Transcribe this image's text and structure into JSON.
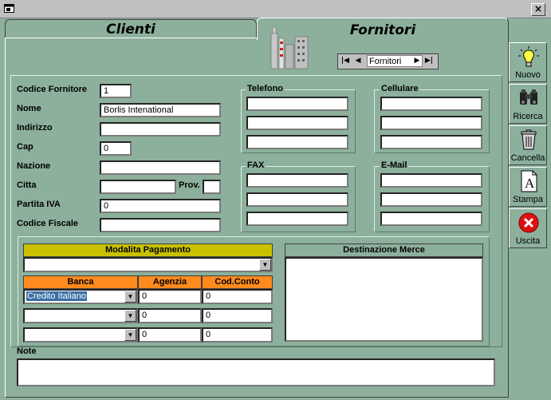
{
  "window": {
    "close_glyph": "×"
  },
  "tabs": [
    {
      "label": "Clienti"
    },
    {
      "label": "Fornitori"
    }
  ],
  "nav": {
    "first": "|◀",
    "prev": "◀",
    "label": "Fornitori",
    "next": "▶",
    "last": "▶|"
  },
  "form": {
    "codice_label": "Codice Fornitore",
    "codice_value": "1",
    "nome_label": "Nome",
    "nome_value": "Borlis Intenational",
    "indirizzo_label": "Indirizzo",
    "indirizzo_value": "",
    "cap_label": "Cap",
    "cap_value": "0",
    "nazione_label": "Nazione",
    "nazione_value": "",
    "citta_label": "Citta",
    "citta_value": "",
    "prov_label": "Prov.",
    "prov_value": "",
    "piva_label": "Partita IVA",
    "piva_value": "0",
    "cf_label": "Codice Fiscale",
    "cf_value": ""
  },
  "contacts": {
    "telefono": "Telefono",
    "cellulare": "Cellulare",
    "fax": "FAX",
    "email": "E-Mail"
  },
  "payment": {
    "modalita_header": "Modalita Pagamento",
    "modalita_value": "",
    "col_banca": "Banca",
    "col_agenzia": "Agenzia",
    "col_conto": "Cod.Conto",
    "rows": [
      {
        "banca": "Credito Italiano",
        "agenzia": "0",
        "conto": "0"
      },
      {
        "banca": "",
        "agenzia": "0",
        "conto": "0"
      },
      {
        "banca": "",
        "agenzia": "0",
        "conto": "0"
      }
    ],
    "destinazione_header": "Destinazione Merce"
  },
  "note": {
    "label": "Note",
    "value": ""
  },
  "toolbar": {
    "nuovo": "Nuovo",
    "ricerca": "Ricerca",
    "cancella": "Cancella",
    "stampa": "Stampa",
    "uscita": "Uscita"
  },
  "colors": {
    "background": "#8cb09c",
    "yellow_header": "#c9c100",
    "orange_header": "#ff8a1e"
  }
}
